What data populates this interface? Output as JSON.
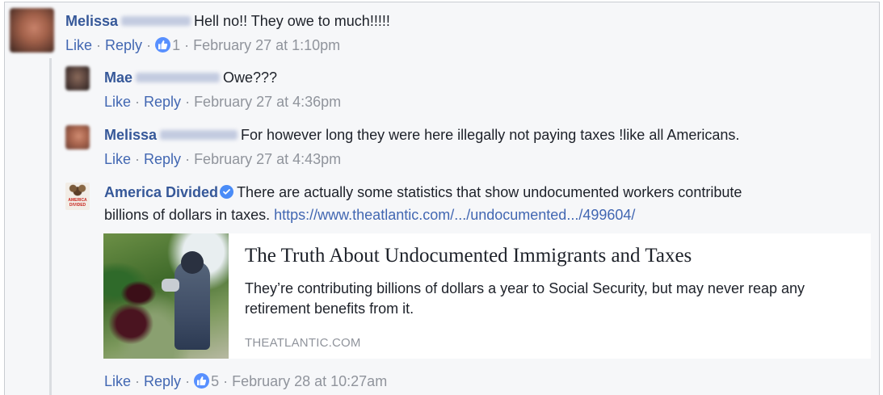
{
  "comments": [
    {
      "author_first": "Melissa",
      "text": "Hell no!! They owe to much!!!!!",
      "like_label": "Like",
      "reply_label": "Reply",
      "reaction_count": "1",
      "timestamp": "February 27 at 1:10pm"
    }
  ],
  "replies": [
    {
      "author_first": "Mae",
      "text": "Owe???",
      "like_label": "Like",
      "reply_label": "Reply",
      "timestamp": "February 27 at 4:36pm"
    },
    {
      "author_first": "Melissa",
      "text": "For however long they were here illegally not paying taxes !like all Americans.",
      "like_label": "Like",
      "reply_label": "Reply",
      "timestamp": "February 27 at 4:43pm"
    },
    {
      "author": "America Divided",
      "avatar_text": "AMERICA DIVIDED",
      "text_line1": "There are actually some statistics that show undocumented workers contribute",
      "text_line2": "billions of dollars in taxes.",
      "link": "https://www.theatlantic.com/.../undocumented.../499604/",
      "like_label": "Like",
      "reply_label": "Reply",
      "reaction_count": "5",
      "timestamp": "February 28 at 10:27am",
      "link_card": {
        "title": "The Truth About Undocumented Immigrants and Taxes",
        "description": "They’re contributing billions of dollars a year to Social Security, but may never reap any retirement benefits from it.",
        "domain": "THEATLANTIC.COM"
      }
    }
  ],
  "separator": " · ",
  "colors": {
    "name_blue": "#365899",
    "link_blue": "#4267b2",
    "meta_gray": "#90949c",
    "like_blue": "#5890ff",
    "background": "#f6f7f9"
  }
}
